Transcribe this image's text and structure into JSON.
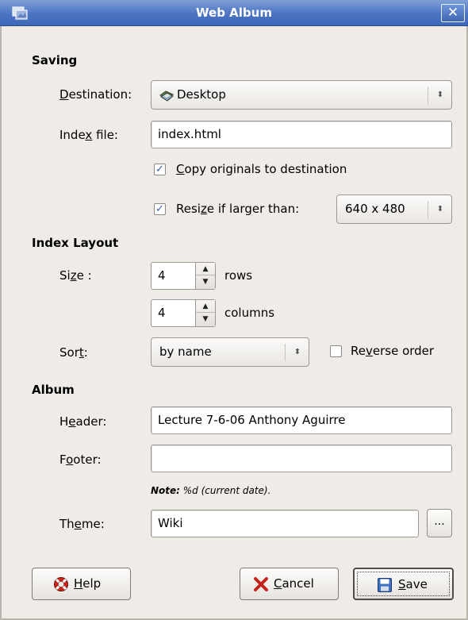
{
  "window": {
    "title": "Web Album",
    "close_label": "✕"
  },
  "saving": {
    "heading": "Saving",
    "destination": {
      "label_pre": "",
      "label_u": "D",
      "label_post": "estination:",
      "value": "Desktop"
    },
    "index_file": {
      "label_pre": "Inde",
      "label_u": "x",
      "label_post": " file:",
      "value": "index.html"
    },
    "copy_originals": {
      "label_pre": "",
      "label_u": "C",
      "label_post": "opy originals to destination",
      "checked": true
    },
    "resize": {
      "label_pre": "Resi",
      "label_u": "z",
      "label_post": "e if larger than:",
      "checked": true,
      "value": "640 x 480"
    }
  },
  "index_layout": {
    "heading": "Index Layout",
    "size_label_pre": "Si",
    "size_label_u": "z",
    "size_label_post": "e :",
    "rows": {
      "value": "4",
      "unit": "rows"
    },
    "columns": {
      "value": "4",
      "unit": "columns"
    },
    "sort": {
      "label_pre": "Sor",
      "label_u": "t",
      "label_post": ":",
      "value": "by name"
    },
    "reverse": {
      "label_pre": "Re",
      "label_u": "v",
      "label_post": "erse order",
      "checked": false
    }
  },
  "album": {
    "heading": "Album",
    "header": {
      "label_pre": "H",
      "label_u": "e",
      "label_post": "ader:",
      "value": "Lecture 7-6-06 Anthony Aguirre"
    },
    "footer": {
      "label_pre": "F",
      "label_u": "o",
      "label_post": "oter:",
      "value": ""
    },
    "note_bold": "Note:",
    "note_text": " %d (current date).",
    "theme": {
      "label_pre": "Th",
      "label_u": "e",
      "label_post": "me:",
      "value": "Wiki",
      "browse_label": "..."
    }
  },
  "buttons": {
    "help": {
      "u": "H",
      "rest": "elp"
    },
    "cancel": {
      "u": "C",
      "rest": "ancel"
    },
    "save": {
      "u": "S",
      "rest": "ave"
    }
  },
  "colors": {
    "titlebar": "#4b74c2",
    "background": "#efebe7"
  }
}
